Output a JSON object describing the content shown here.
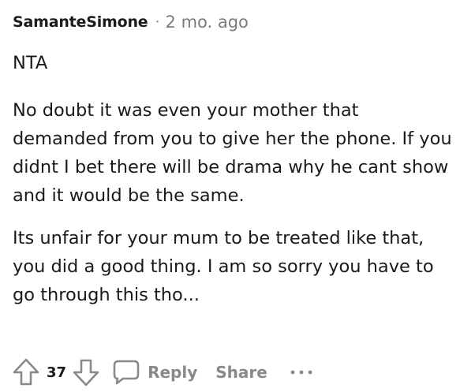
{
  "comment": {
    "author": "SamanteSimone",
    "separator": "·",
    "timestamp": "2 mo. ago",
    "paragraphs": [
      "NTA",
      "No doubt it was even your mother that demanded from you to give her the phone. If you didnt I bet there will be drama why he cant show and it would be the same.",
      "Its unfair for your mum to be treated like that, you did a good thing. I am so sorry you have to go through this tho..."
    ]
  },
  "actions": {
    "upvote_icon": "arrow-up-icon",
    "vote_count": "37",
    "downvote_icon": "arrow-down-icon",
    "reply_icon": "speech-bubble-icon",
    "reply_label": "Reply",
    "share_label": "Share",
    "more_icon": "ellipsis-icon"
  },
  "colors": {
    "text": "#1a1a1b",
    "muted": "#878a8c",
    "background": "#ffffff"
  }
}
